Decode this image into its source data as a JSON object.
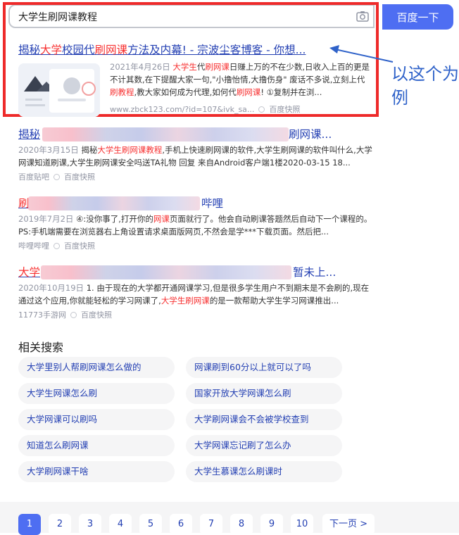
{
  "search": {
    "query": "大学生刷网课教程",
    "button_label": "百度一下"
  },
  "annotation": {
    "text": "以这个为例"
  },
  "results": [
    {
      "title_parts": [
        "揭秘",
        "大学",
        "校园代",
        "刷网课",
        "方法及内幕! - 宗波尘客博客 - 你想..."
      ],
      "date": "2021年4月26日",
      "body_parts": [
        " ",
        "大学生",
        "代",
        "刷网课",
        "日赚上万的不在少数,日收入上百的更是不计其数,在下提醒大家一句,\"小撸怡情,大撸伤身\" 废话不多说,立刻上代",
        "刷教程",
        ",教大家如何成为代理,如何代",
        "刷网课",
        "! ①复制并在浏..."
      ],
      "source": "www.zbck123.com/?id=107&ivk_sa...",
      "snapshot": "百度快照"
    },
    {
      "title_start": "揭秘",
      "title_end": "刷网课...",
      "date": "2020年3月15日",
      "body_parts": [
        " 揭秘",
        "大学生刷网课教程",
        ",手机上快速刷网课的软件,大学生刷网课的软件叫什么,大学网课知道刷课,大学生刷网课安全吗送TA礼物 回复 来自Android客户端1楼2020-03-15 18..."
      ],
      "source": "百度贴吧",
      "snapshot": "百度快照"
    },
    {
      "title_start": "刷",
      "title_end": "哔哩",
      "date": "2019年7月2日",
      "body_parts": [
        " ④:没你事了,打开你的",
        "网课",
        "页面就行了。他会自动刷课答题然后自动下一个课程的。 PS:手机端需要在浏览器右上角设置请求桌面版网页,不然会是学***下载页面。然后把..."
      ],
      "source": "哔哩哔哩",
      "snapshot": "百度快照"
    },
    {
      "title_start": "大学",
      "title_end": "暂未上...",
      "date": "2020年10月19日",
      "body_parts": [
        " 1. 由于现在的大学都开通网课学习,但是很多学生用户不到期末是不会刷的,现在通过这个应用,你就能轻松的学习网课了,",
        "大学生刷网课",
        "的是一款帮助大学生学习网课推出..."
      ],
      "source": "11773手游网",
      "snapshot": "百度快照"
    }
  ],
  "related": {
    "title": "相关搜索",
    "items": [
      "大学里别人帮刷网课怎么做的",
      "网课刷到60分以上就可以了吗",
      "大学生网课怎么刷",
      "国家开放大学网课怎么刷",
      "大学网课可以刷吗",
      "大学刷网课会不会被学校查到",
      "知道怎么刷网课",
      "大学网课忘记刷了怎么办",
      "大学刷网课干啥",
      "大学生慕课怎么刷课时"
    ]
  },
  "pagination": {
    "pages": [
      "1",
      "2",
      "3",
      "4",
      "5",
      "6",
      "7",
      "8",
      "9",
      "10"
    ],
    "current": "1",
    "next_label": "下一页 >"
  },
  "colors": {
    "accent": "#4e6ef2",
    "link": "#2440b3",
    "highlight": "#f73131",
    "annotation_frame": "#ee2a2a",
    "annotation_text": "#2f62c9"
  }
}
